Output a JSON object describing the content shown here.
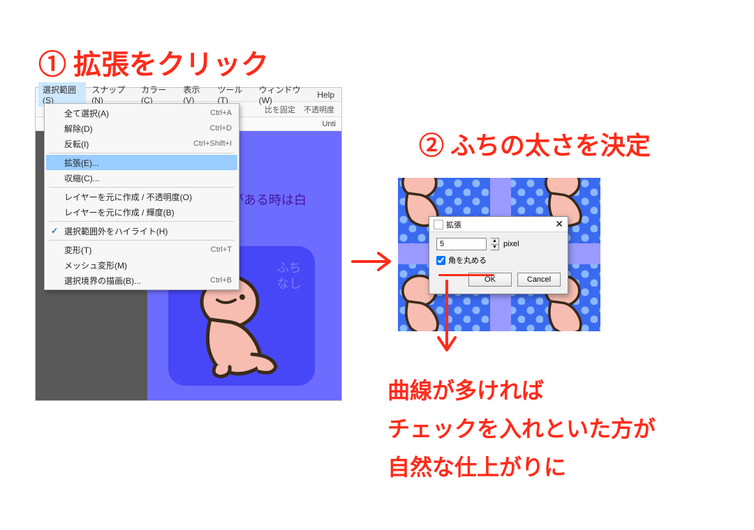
{
  "annotations": {
    "step1": "① 拡張をクリック",
    "step2": "② ふちの太さを決定",
    "note_line1": "曲線が多ければ",
    "note_line2": "チェックを入れといた方が",
    "note_line3": "自然な仕上がりに"
  },
  "menubar": {
    "items": [
      "選択範囲(S)",
      "スナップ(N)",
      "カラー(C)",
      "表示(V)",
      "ツール(T)",
      "ウィンドウ(W)",
      "Help"
    ],
    "active_index": 0
  },
  "toolbar": {
    "ratio_lock": "比を固定",
    "opacity": "不透明度"
  },
  "tab": {
    "name": "Unti"
  },
  "dropdown": {
    "groups": [
      [
        {
          "label": "全て選択(A)",
          "shortcut": "Ctrl+A"
        },
        {
          "label": "解除(D)",
          "shortcut": "Ctrl+D"
        },
        {
          "label": "反転(I)",
          "shortcut": "Ctrl+Shift+I"
        }
      ],
      [
        {
          "label": "拡張(E)...",
          "highlight": true
        },
        {
          "label": "収縮(C)..."
        }
      ],
      [
        {
          "label": "レイヤーを元に作成 / 不透明度(O)"
        },
        {
          "label": "レイヤーを元に作成 / 輝度(B)"
        }
      ],
      [
        {
          "label": "選択範囲外をハイライト(H)",
          "checked": true
        }
      ],
      [
        {
          "label": "変形(T)",
          "shortcut": "Ctrl+T"
        },
        {
          "label": "メッシュ変形(M)"
        },
        {
          "label": "選択境界の描画(B)...",
          "shortcut": "Ctrl+B"
        }
      ]
    ]
  },
  "canvas": {
    "top_text": "がある時は白",
    "fuchi_label": "ふち\nなし"
  },
  "dialog": {
    "title": "拡張",
    "value": "5",
    "unit": "pixel",
    "round_checkbox_label": "角を丸める",
    "round_checked": true,
    "ok": "OK",
    "cancel": "Cancel"
  }
}
